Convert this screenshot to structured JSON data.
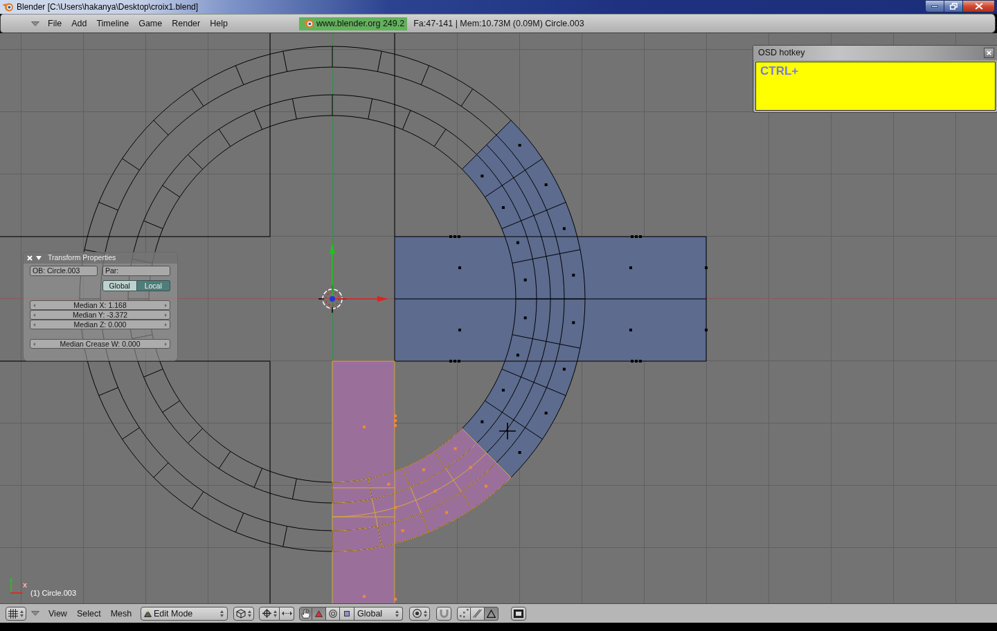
{
  "window": {
    "title": "Blender [C:\\Users\\hakanya\\Desktop\\croix1.blend]"
  },
  "menu_bar": {
    "menus": [
      "File",
      "Add",
      "Timeline",
      "Game",
      "Render",
      "Help"
    ],
    "version": "www.blender.org 249.2",
    "stats": "Fa:47-141 | Mem:10.73M (0.09M) Circle.003"
  },
  "viewport": {
    "osd_panel": {
      "title": "OSD hotkey",
      "keys": "CTRL+"
    },
    "transform_panel": {
      "title": "Transform Properties",
      "object_field": "OB: Circle.003",
      "parent_field": "Par:",
      "space_options": [
        {
          "label": "Global",
          "selected": false
        },
        {
          "label": "Local",
          "selected": true
        }
      ],
      "median_fields": [
        "Median X: 1.168",
        "Median Y: -3.372",
        "Median Z: 0.000"
      ],
      "crease_field": "Median Crease W: 0.000"
    },
    "axis_label": "x",
    "object_label": "(1) Circle.003"
  },
  "viewport_header": {
    "menus": [
      "View",
      "Select",
      "Mesh"
    ],
    "mode": "Edit Mode",
    "manipulator": {
      "on": true
    },
    "transform_modes": [
      {
        "kind": "translate",
        "selected": true
      },
      {
        "kind": "rotate",
        "selected": false
      },
      {
        "kind": "scale",
        "selected": false
      }
    ],
    "orientation": "Global",
    "select_modes": [
      {
        "kind": "vertex",
        "selected": false
      },
      {
        "kind": "edge",
        "selected": false
      },
      {
        "kind": "face",
        "selected": true
      }
    ]
  }
}
